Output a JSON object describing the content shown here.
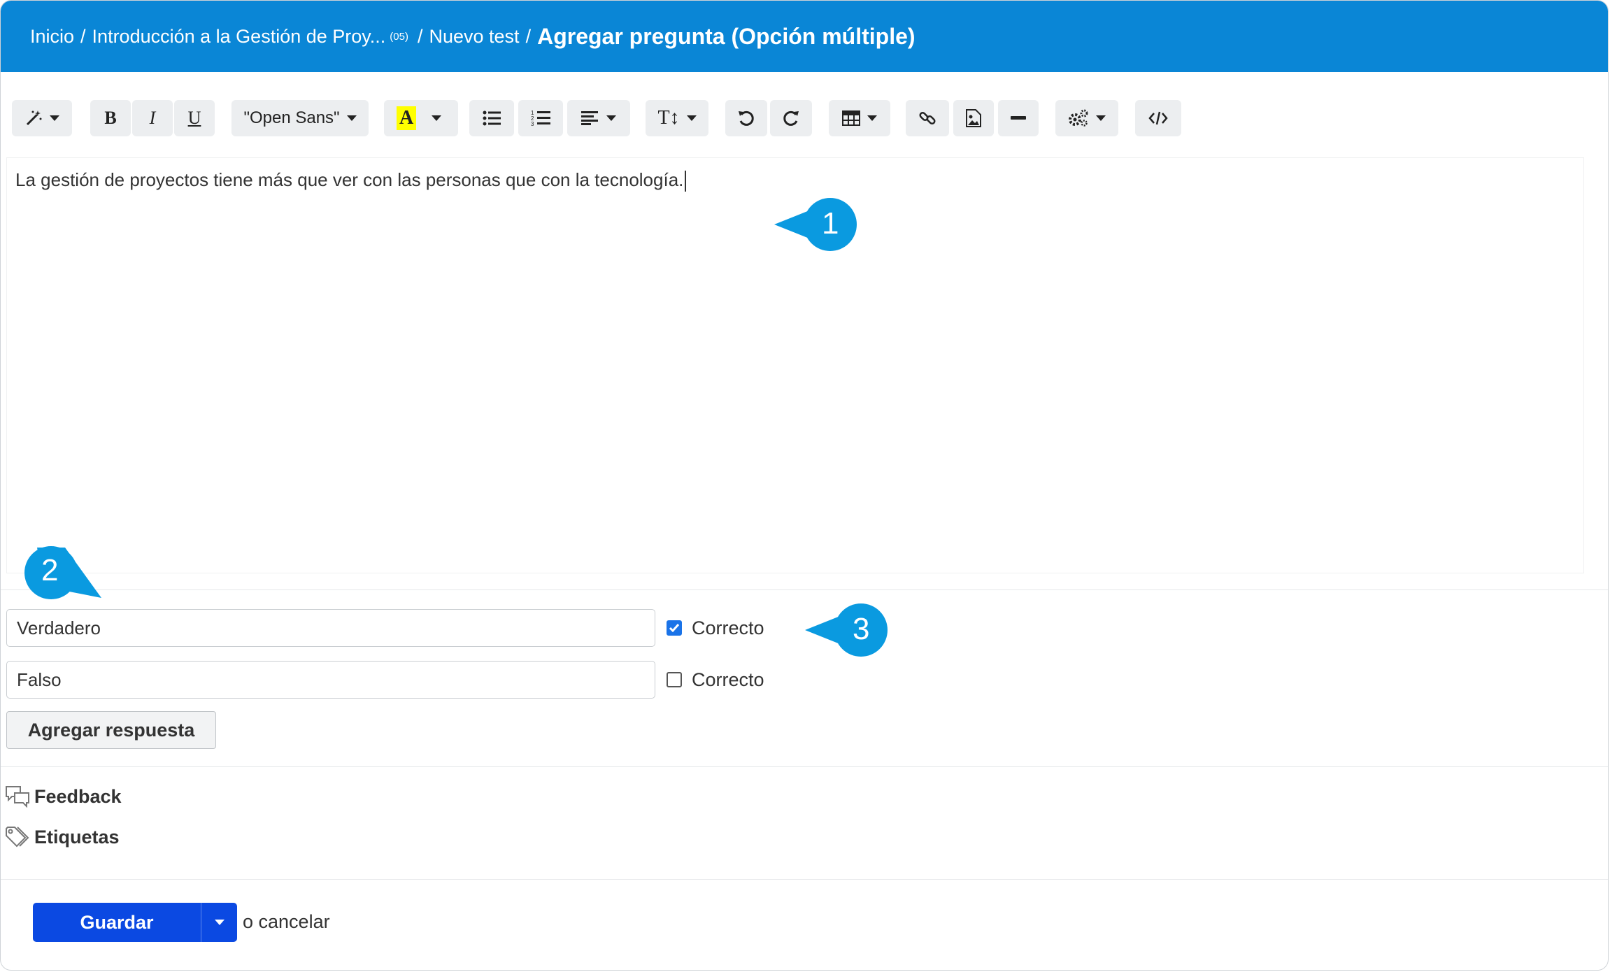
{
  "header": {
    "breadcrumb": [
      {
        "label": "Inicio"
      },
      {
        "label": "Introducción a la Gestión de Proy...",
        "badge": "(05)"
      },
      {
        "label": "Nuevo test"
      }
    ],
    "separator": "/",
    "current": "Agregar pregunta (Opción múltiple)",
    "background": "#0a86d6"
  },
  "toolbar": {
    "font_name": "\"Open Sans\"",
    "highlight_glyph": "A",
    "bold": "B",
    "italic": "I",
    "underline": "U",
    "text_size_glyph": "T↕",
    "icons": [
      "magic-icon",
      "bold-icon",
      "italic-icon",
      "underline-icon",
      "font-family-select",
      "highlight-color-icon",
      "bullet-list-icon",
      "numbered-list-icon",
      "align-icon",
      "text-size-icon",
      "undo-icon",
      "redo-icon",
      "table-icon",
      "link-icon",
      "image-icon",
      "horizontal-rule-icon",
      "settings-icon",
      "code-view-icon"
    ]
  },
  "editor": {
    "content": "La gestión de proyectos tiene más que ver con las personas que con la tecnología."
  },
  "answers": [
    {
      "value": "Verdadero",
      "correct": true,
      "correct_label": "Correcto"
    },
    {
      "value": "Falso",
      "correct": false,
      "correct_label": "Correcto"
    }
  ],
  "add_answer_label": "Agregar respuesta",
  "sections": {
    "feedback": "Feedback",
    "tags": "Etiquetas"
  },
  "footer": {
    "save_label": "Guardar",
    "cancel_label": "o cancelar",
    "save_color": "#0b49e2"
  },
  "callouts": [
    "1",
    "2",
    "3"
  ],
  "callout_color": "#0a9ae0"
}
